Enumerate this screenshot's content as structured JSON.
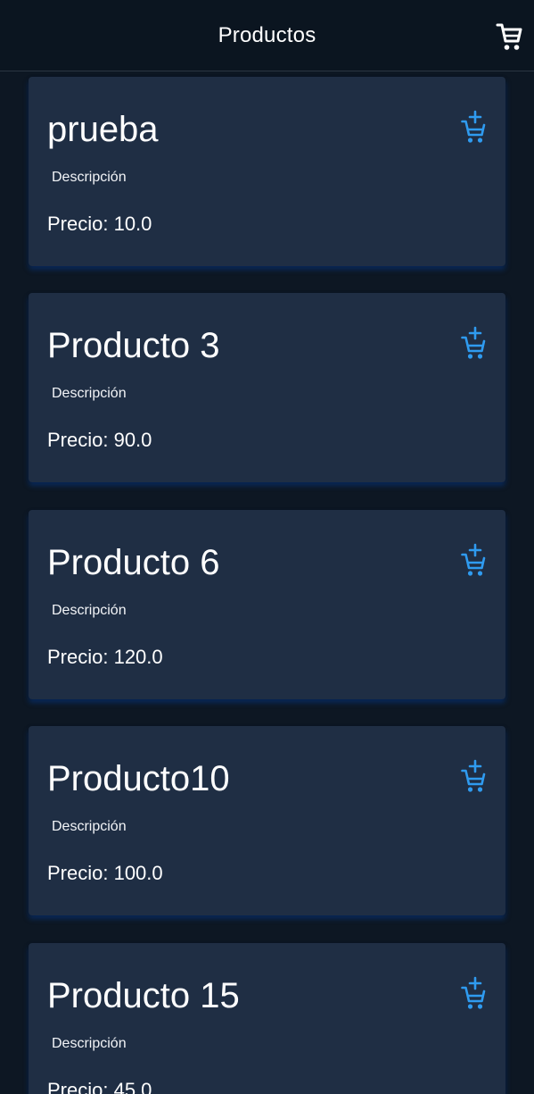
{
  "app_bar": {
    "title": "Productos",
    "cart_icon": "shopping-cart-icon"
  },
  "products": [
    {
      "name": "prueba",
      "description": "Descripción",
      "price": "Precio: 10.0",
      "action_icon": "add-shopping-cart-icon"
    },
    {
      "name": "Producto 3",
      "description": "Descripción",
      "price": "Precio: 90.0",
      "action_icon": "add-shopping-cart-icon"
    },
    {
      "name": "Producto 6",
      "description": "Descripción",
      "price": "Precio: 120.0",
      "action_icon": "add-shopping-cart-icon"
    },
    {
      "name": "Producto10",
      "description": "Descripción",
      "price": "Precio: 100.0",
      "action_icon": "add-shopping-cart-icon"
    },
    {
      "name": "Producto 15",
      "description": "Descripción",
      "price": "Precio: 45.0",
      "action_icon": "add-shopping-cart-icon"
    }
  ],
  "colors": {
    "background": "#0d1723",
    "app_bar": "#0b1520",
    "card": "#1f2e44",
    "accent": "#2f9bf0"
  }
}
